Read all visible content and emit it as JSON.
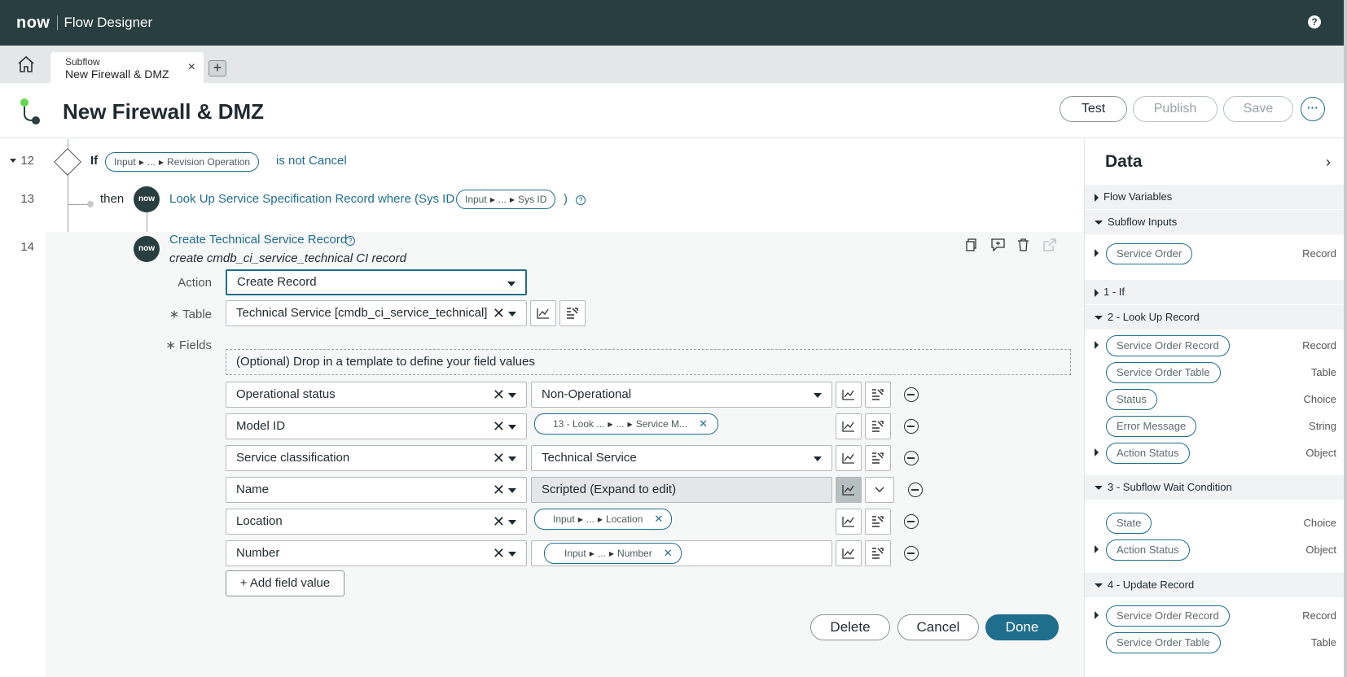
{
  "app": {
    "logo": "now",
    "title": "Flow Designer",
    "help": "?"
  },
  "tab": {
    "type": "Subflow",
    "name": "New Firewall & DMZ",
    "close": "×",
    "add": "+"
  },
  "header": {
    "title": "New Firewall & DMZ",
    "test": "Test",
    "publish": "Publish",
    "save": "Save",
    "more": "···"
  },
  "steps": {
    "s12": {
      "num": "12",
      "keyword": "If",
      "pill": [
        "Input",
        "...",
        "Revision Operation"
      ],
      "cond": "is not Cancel"
    },
    "s13": {
      "num": "13",
      "keyword": "then",
      "badge": "now",
      "text": "Look Up Service Specification Record where (Sys ID is",
      "pill": [
        "Input",
        "...",
        "Sys ID"
      ],
      "close": ")"
    },
    "s14": {
      "num": "14",
      "badge": "now",
      "title": "Create Technical Service Record",
      "subtitle": "create cmdb_ci_service_technical CI record"
    }
  },
  "form": {
    "action_label": "Action",
    "action_value": "Create Record",
    "table_label": "∗ Table",
    "table_value": "Technical Service [cmdb_ci_service_technical]",
    "fields_label": "∗ Fields",
    "dropzone": "(Optional) Drop in a template to define your field values",
    "rows": [
      {
        "field": "Operational status",
        "value": "Non-Operational"
      },
      {
        "field": "Model ID",
        "pill": [
          "13 - Look ...",
          "...",
          "Service M..."
        ]
      },
      {
        "field": "Service classification",
        "value": "Technical Service"
      },
      {
        "field": "Name",
        "value": "Scripted (Expand to edit)"
      },
      {
        "field": "Location",
        "pill": [
          "Input",
          "...",
          "Location"
        ]
      },
      {
        "field": "Number",
        "pill": [
          "Input",
          "...",
          "Number"
        ]
      }
    ],
    "add_field": "Add field value",
    "delete": "Delete",
    "cancel": "Cancel",
    "done": "Done"
  },
  "panel": {
    "title": "Data",
    "sections": [
      {
        "label": "Flow Variables",
        "open": false
      },
      {
        "label": "Subflow Inputs",
        "open": true
      },
      {
        "label": "1 - If",
        "open": false
      },
      {
        "label": "2 - Look Up Record",
        "open": true
      },
      {
        "label": "3 - Subflow Wait Condition",
        "open": true
      },
      {
        "label": "4 - Update Record",
        "open": true
      }
    ],
    "items": [
      {
        "label": "Service Order",
        "type": "Record"
      },
      {
        "label": "Service Order Record",
        "type": "Record"
      },
      {
        "label": "Service Order Table",
        "type": "Table"
      },
      {
        "label": "Status",
        "type": "Choice"
      },
      {
        "label": "Error Message",
        "type": "String"
      },
      {
        "label": "Action Status",
        "type": "Object"
      },
      {
        "label": "State",
        "type": "Choice"
      },
      {
        "label": "Action Status",
        "type": "Object"
      },
      {
        "label": "Service Order Record",
        "type": "Record"
      },
      {
        "label": "Service Order Table",
        "type": "Table"
      }
    ]
  }
}
